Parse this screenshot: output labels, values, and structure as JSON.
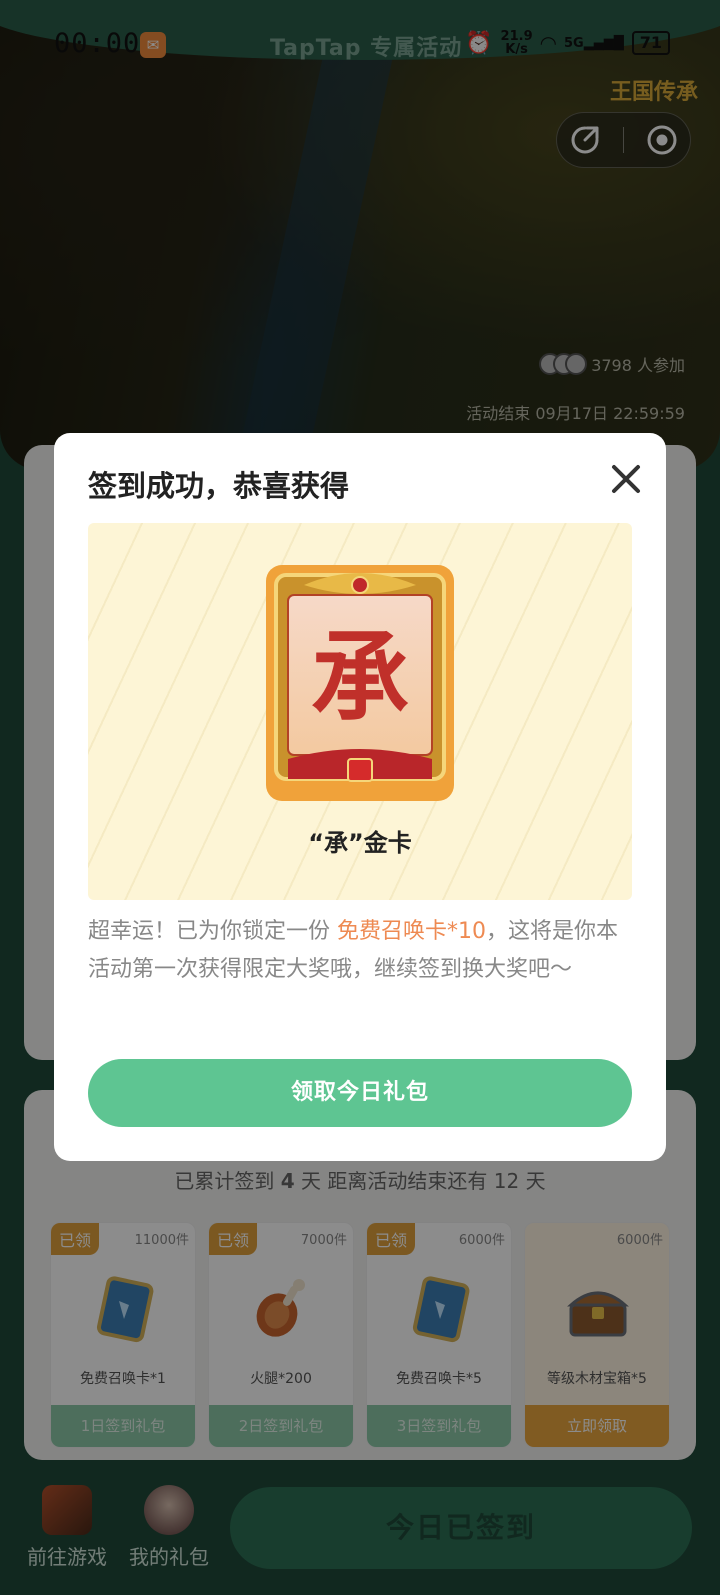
{
  "status_bar": {
    "time": "00:00",
    "caption": "TapTap 专属活动",
    "net_speed_value": "21.9",
    "net_speed_unit": "K/s",
    "network": "5G",
    "battery": "71"
  },
  "hero": {
    "game_logo": "王国传承",
    "participants": "3798 人参加",
    "end_time": "活动结束 09月17日 22:59:59"
  },
  "signin": {
    "progress_prefix": "已累计签到 ",
    "progress_days": "4",
    "progress_suffix": " 天  距离活动结束还有 12 天",
    "rewards": [
      {
        "badge": "已领",
        "stock": "11000件",
        "name": "免费召唤卡*1",
        "action": "1日签到礼包",
        "icon": "summon-card-icon"
      },
      {
        "badge": "已领",
        "stock": "7000件",
        "name": "火腿*200",
        "action": "2日签到礼包",
        "icon": "ham-icon"
      },
      {
        "badge": "已领",
        "stock": "6000件",
        "name": "免费召唤卡*5",
        "action": "3日签到礼包",
        "icon": "summon-card-icon"
      },
      {
        "badge": "",
        "stock": "6000件",
        "name": "等级木材宝箱*5",
        "action": "立即领取",
        "icon": "treasure-chest-icon"
      }
    ]
  },
  "bottom_bar": {
    "go_game": "前往游戏",
    "my_gifts": "我的礼包",
    "checked_in": "今日已签到"
  },
  "modal": {
    "title": "签到成功，恭喜获得",
    "card_glyph": "承",
    "prize_name": "“承”金卡",
    "desc_part1": "超幸运！已为你锁定一份 ",
    "desc_highlight": "免费召唤卡*10",
    "desc_part2": "，这将是你本活动第一次获得限定大奖哦，继续签到换大奖吧～",
    "claim_label": "领取今日礼包"
  },
  "colors": {
    "accent_green": "#5ec592",
    "highlight_orange": "#ee8a52",
    "badge_gold": "#e0a13c",
    "dark_green": "#1f4a3a"
  }
}
